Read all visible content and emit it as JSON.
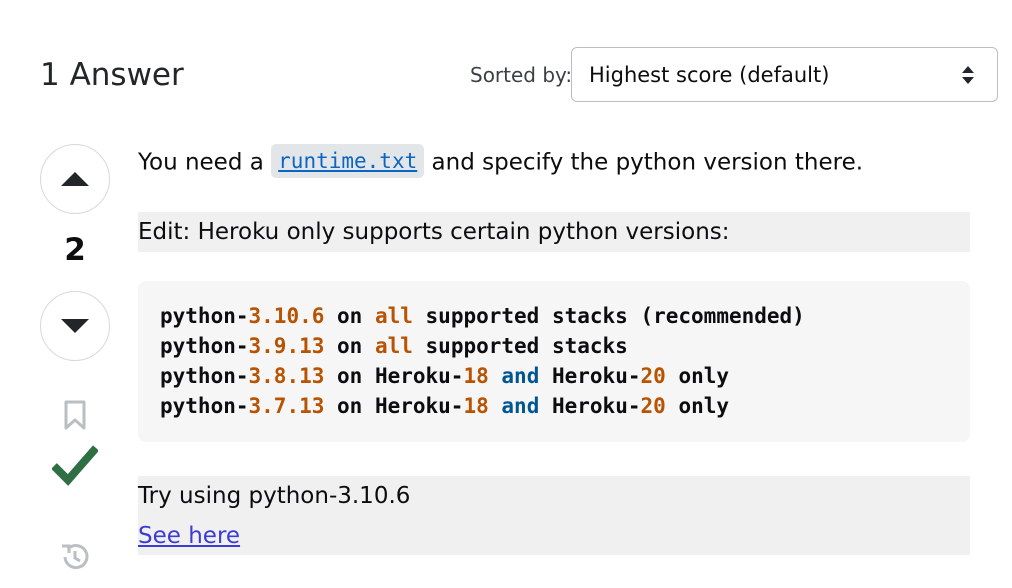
{
  "header": {
    "answers_count": "1 Answer",
    "sort_label": "Sorted by:",
    "sort_selected": "Highest score (default)"
  },
  "vote": {
    "score": "2"
  },
  "post": {
    "line1_before": "You need a ",
    "line1_link": "runtime.txt",
    "line1_after": " and specify the python version there.",
    "edit_text": "Edit: Heroku only supports certain python versions:",
    "code_lines": [
      [
        {
          "t": "python-",
          "c": "plain"
        },
        {
          "t": "3.10.6",
          "c": "num"
        },
        {
          "t": " on ",
          "c": "plain"
        },
        {
          "t": "all",
          "c": "kw"
        },
        {
          "t": " supported stacks (recommended)",
          "c": "plain"
        }
      ],
      [
        {
          "t": "python-",
          "c": "plain"
        },
        {
          "t": "3.9.13",
          "c": "num"
        },
        {
          "t": " on ",
          "c": "plain"
        },
        {
          "t": "all",
          "c": "kw"
        },
        {
          "t": " supported stacks",
          "c": "plain"
        }
      ],
      [
        {
          "t": "python-",
          "c": "plain"
        },
        {
          "t": "3.8.13",
          "c": "num"
        },
        {
          "t": " on Heroku-",
          "c": "plain"
        },
        {
          "t": "18",
          "c": "num"
        },
        {
          "t": " ",
          "c": "plain"
        },
        {
          "t": "and",
          "c": "and"
        },
        {
          "t": " Heroku-",
          "c": "plain"
        },
        {
          "t": "20",
          "c": "num"
        },
        {
          "t": " only",
          "c": "plain"
        }
      ],
      [
        {
          "t": "python-",
          "c": "plain"
        },
        {
          "t": "3.7.13",
          "c": "num"
        },
        {
          "t": " on Heroku-",
          "c": "plain"
        },
        {
          "t": "18",
          "c": "num"
        },
        {
          "t": " ",
          "c": "plain"
        },
        {
          "t": "and",
          "c": "and"
        },
        {
          "t": " Heroku-",
          "c": "plain"
        },
        {
          "t": "20",
          "c": "num"
        },
        {
          "t": " only",
          "c": "plain"
        }
      ]
    ],
    "try_text": "Try using python-3.10.6",
    "see_here": "See here"
  },
  "icons": {
    "upvote": "caret-up-icon",
    "downvote": "caret-down-icon",
    "bookmark": "bookmark-icon",
    "accepted": "checkmark-icon",
    "history": "history-icon",
    "sort": "sort-arrows-icon"
  },
  "colors": {
    "accepted_green": "#2f6f44",
    "link_blue": "#0a66c2",
    "code_number": "#b75301",
    "code_keyword_and": "#015692"
  }
}
